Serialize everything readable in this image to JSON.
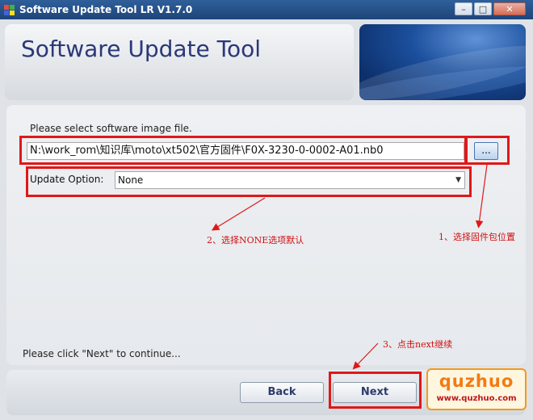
{
  "window": {
    "title": "Software Update Tool LR V1.7.0",
    "min_icon": "minimize-icon",
    "max_icon": "maximize-icon",
    "close_icon": "close-icon"
  },
  "header": {
    "title": "Software Update Tool"
  },
  "form": {
    "prompt": "Please select software image file.",
    "file_path": "N:\\work_rom\\知识库\\moto\\xt502\\官方固件\\F0X-3230-0-0002-A01.nb0",
    "browse_label": "...",
    "option_label": "Update Option:",
    "option_value": "None",
    "continue_text": "Please click \"Next\" to continue..."
  },
  "buttons": {
    "back": "Back",
    "next": "Next"
  },
  "annotations": {
    "step1": "1、选择固件包位置",
    "step2": "2、选择NONE选项默认",
    "step3": "3、点击next继续"
  },
  "watermark": {
    "brand": "quzhuo",
    "url": "www.quzhuo.com"
  },
  "colors": {
    "annotation": "#e01818",
    "title_text": "#2a3878",
    "watermark_accent": "#f27b12"
  }
}
